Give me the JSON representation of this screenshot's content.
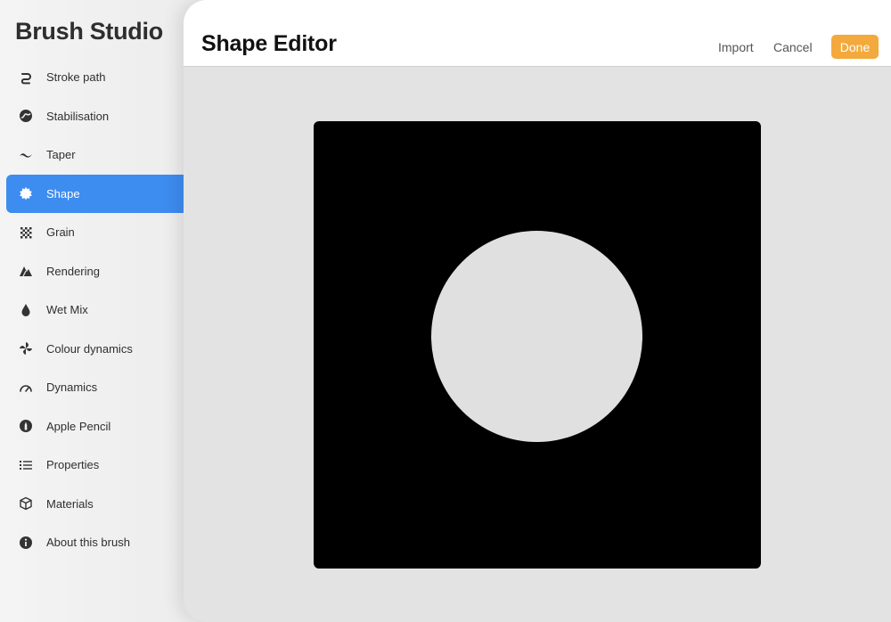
{
  "sidebar": {
    "title": "Brush Studio",
    "items": [
      {
        "label": "Stroke path",
        "icon": "stroke-path-icon",
        "active": false
      },
      {
        "label": "Stabilisation",
        "icon": "stabilisation-icon",
        "active": false
      },
      {
        "label": "Taper",
        "icon": "taper-icon",
        "active": false
      },
      {
        "label": "Shape",
        "icon": "shape-icon",
        "active": true
      },
      {
        "label": "Grain",
        "icon": "grain-icon",
        "active": false
      },
      {
        "label": "Rendering",
        "icon": "rendering-icon",
        "active": false
      },
      {
        "label": "Wet Mix",
        "icon": "wet-mix-icon",
        "active": false
      },
      {
        "label": "Colour dynamics",
        "icon": "colour-dynamics-icon",
        "active": false
      },
      {
        "label": "Dynamics",
        "icon": "dynamics-icon",
        "active": false
      },
      {
        "label": "Apple Pencil",
        "icon": "apple-pencil-icon",
        "active": false
      },
      {
        "label": "Properties",
        "icon": "properties-icon",
        "active": false
      },
      {
        "label": "Materials",
        "icon": "materials-icon",
        "active": false
      },
      {
        "label": "About this brush",
        "icon": "info-icon",
        "active": false
      }
    ]
  },
  "editor": {
    "title": "Shape Editor",
    "import_label": "Import",
    "cancel_label": "Cancel",
    "done_label": "Done"
  },
  "colors": {
    "accent_active": "#3d8cf0",
    "done_button": "#f3a93c",
    "canvas_background": "#000000",
    "shape_fill": "#e0e0e0"
  }
}
